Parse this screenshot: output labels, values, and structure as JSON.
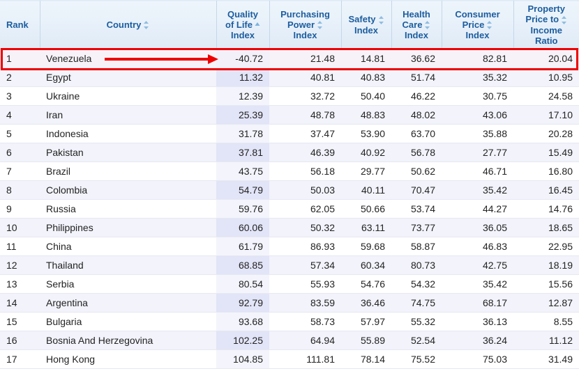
{
  "table": {
    "columns": [
      {
        "key": "rank",
        "label": "Rank",
        "align": "left",
        "sort": "none",
        "icon": ""
      },
      {
        "key": "country",
        "label": "Country",
        "align": "left",
        "sort": "sortable",
        "icon": "sort-both-icon"
      },
      {
        "key": "qol",
        "label": "Quality of Life Index",
        "align": "right",
        "sort": "ascending",
        "icon": "sort-ascending-icon"
      },
      {
        "key": "ppi",
        "label": "Purchasing Power Index",
        "align": "right",
        "sort": "sortable",
        "icon": "sort-both-icon"
      },
      {
        "key": "safety",
        "label": "Safety Index",
        "align": "right",
        "sort": "sortable",
        "icon": "sort-both-icon"
      },
      {
        "key": "health",
        "label": "Health Care Index",
        "align": "right",
        "sort": "sortable",
        "icon": "sort-both-icon"
      },
      {
        "key": "cpi",
        "label": "Consumer Price Index",
        "align": "right",
        "sort": "sortable",
        "icon": "sort-both-icon"
      },
      {
        "key": "ppir",
        "label": "Property Price to Income Ratio",
        "align": "right",
        "sort": "sortable",
        "icon": "sort-both-icon"
      }
    ],
    "column_label_lines": [
      [
        "Rank"
      ],
      [
        "Country"
      ],
      [
        "Quality",
        "of Life",
        "Index"
      ],
      [
        "Purchasing",
        "Power",
        "Index"
      ],
      [
        "Safety",
        "Index"
      ],
      [
        "Health",
        "Care",
        "Index"
      ],
      [
        "Consumer",
        "Price",
        "Index"
      ],
      [
        "Property",
        "Price to",
        "Income",
        "Ratio"
      ]
    ],
    "rows": [
      {
        "rank": "1",
        "country": "Venezuela",
        "qol": "-40.72",
        "ppi": "21.48",
        "safety": "14.81",
        "health": "36.62",
        "cpi": "82.81",
        "ppir": "20.04"
      },
      {
        "rank": "2",
        "country": "Egypt",
        "qol": "11.32",
        "ppi": "40.81",
        "safety": "40.83",
        "health": "51.74",
        "cpi": "35.32",
        "ppir": "10.95"
      },
      {
        "rank": "3",
        "country": "Ukraine",
        "qol": "12.39",
        "ppi": "32.72",
        "safety": "50.40",
        "health": "46.22",
        "cpi": "30.75",
        "ppir": "24.58"
      },
      {
        "rank": "4",
        "country": "Iran",
        "qol": "25.39",
        "ppi": "48.78",
        "safety": "48.83",
        "health": "48.02",
        "cpi": "43.06",
        "ppir": "17.10"
      },
      {
        "rank": "5",
        "country": "Indonesia",
        "qol": "31.78",
        "ppi": "37.47",
        "safety": "53.90",
        "health": "63.70",
        "cpi": "35.88",
        "ppir": "20.28"
      },
      {
        "rank": "6",
        "country": "Pakistan",
        "qol": "37.81",
        "ppi": "46.39",
        "safety": "40.92",
        "health": "56.78",
        "cpi": "27.77",
        "ppir": "15.49"
      },
      {
        "rank": "7",
        "country": "Brazil",
        "qol": "43.75",
        "ppi": "56.18",
        "safety": "29.77",
        "health": "50.62",
        "cpi": "46.71",
        "ppir": "16.80"
      },
      {
        "rank": "8",
        "country": "Colombia",
        "qol": "54.79",
        "ppi": "50.03",
        "safety": "40.11",
        "health": "70.47",
        "cpi": "35.42",
        "ppir": "16.45"
      },
      {
        "rank": "9",
        "country": "Russia",
        "qol": "59.76",
        "ppi": "62.05",
        "safety": "50.66",
        "health": "53.74",
        "cpi": "44.27",
        "ppir": "14.76"
      },
      {
        "rank": "10",
        "country": "Philippines",
        "qol": "60.06",
        "ppi": "50.32",
        "safety": "63.11",
        "health": "73.77",
        "cpi": "36.05",
        "ppir": "18.65"
      },
      {
        "rank": "11",
        "country": "China",
        "qol": "61.79",
        "ppi": "86.93",
        "safety": "59.68",
        "health": "58.87",
        "cpi": "46.83",
        "ppir": "22.95"
      },
      {
        "rank": "12",
        "country": "Thailand",
        "qol": "68.85",
        "ppi": "57.34",
        "safety": "60.34",
        "health": "80.73",
        "cpi": "42.75",
        "ppir": "18.19"
      },
      {
        "rank": "13",
        "country": "Serbia",
        "qol": "80.54",
        "ppi": "55.93",
        "safety": "54.76",
        "health": "54.32",
        "cpi": "35.42",
        "ppir": "15.56"
      },
      {
        "rank": "14",
        "country": "Argentina",
        "qol": "92.79",
        "ppi": "83.59",
        "safety": "36.46",
        "health": "74.75",
        "cpi": "68.17",
        "ppir": "12.87"
      },
      {
        "rank": "15",
        "country": "Bulgaria",
        "qol": "93.68",
        "ppi": "58.73",
        "safety": "57.97",
        "health": "55.32",
        "cpi": "36.13",
        "ppir": "8.55"
      },
      {
        "rank": "16",
        "country": "Bosnia And Herzegovina",
        "qol": "102.25",
        "ppi": "64.94",
        "safety": "55.89",
        "health": "52.54",
        "cpi": "36.24",
        "ppir": "11.12"
      },
      {
        "rank": "17",
        "country": "Hong Kong",
        "qol": "104.85",
        "ppi": "111.81",
        "safety": "78.14",
        "health": "75.52",
        "cpi": "75.03",
        "ppir": "31.49"
      }
    ]
  },
  "annotation": {
    "highlighted_row_rank": "1",
    "highlighted_row_country": "Venezuela",
    "highlighted_value": "-40.72",
    "box_color": "#ee0000",
    "arrow_color": "#ee0000",
    "arrow_points_to": "qol"
  },
  "colors": {
    "header_text": "#1c5d9e",
    "header_bg_top": "#eef5fb",
    "header_bg_bottom": "#dfeaf6",
    "row_even_bg": "#f2f3fb",
    "row_odd_bg": "#ffffff",
    "sorted_column_bg": "#e2e4f7",
    "highlight_border": "#ee0000"
  }
}
